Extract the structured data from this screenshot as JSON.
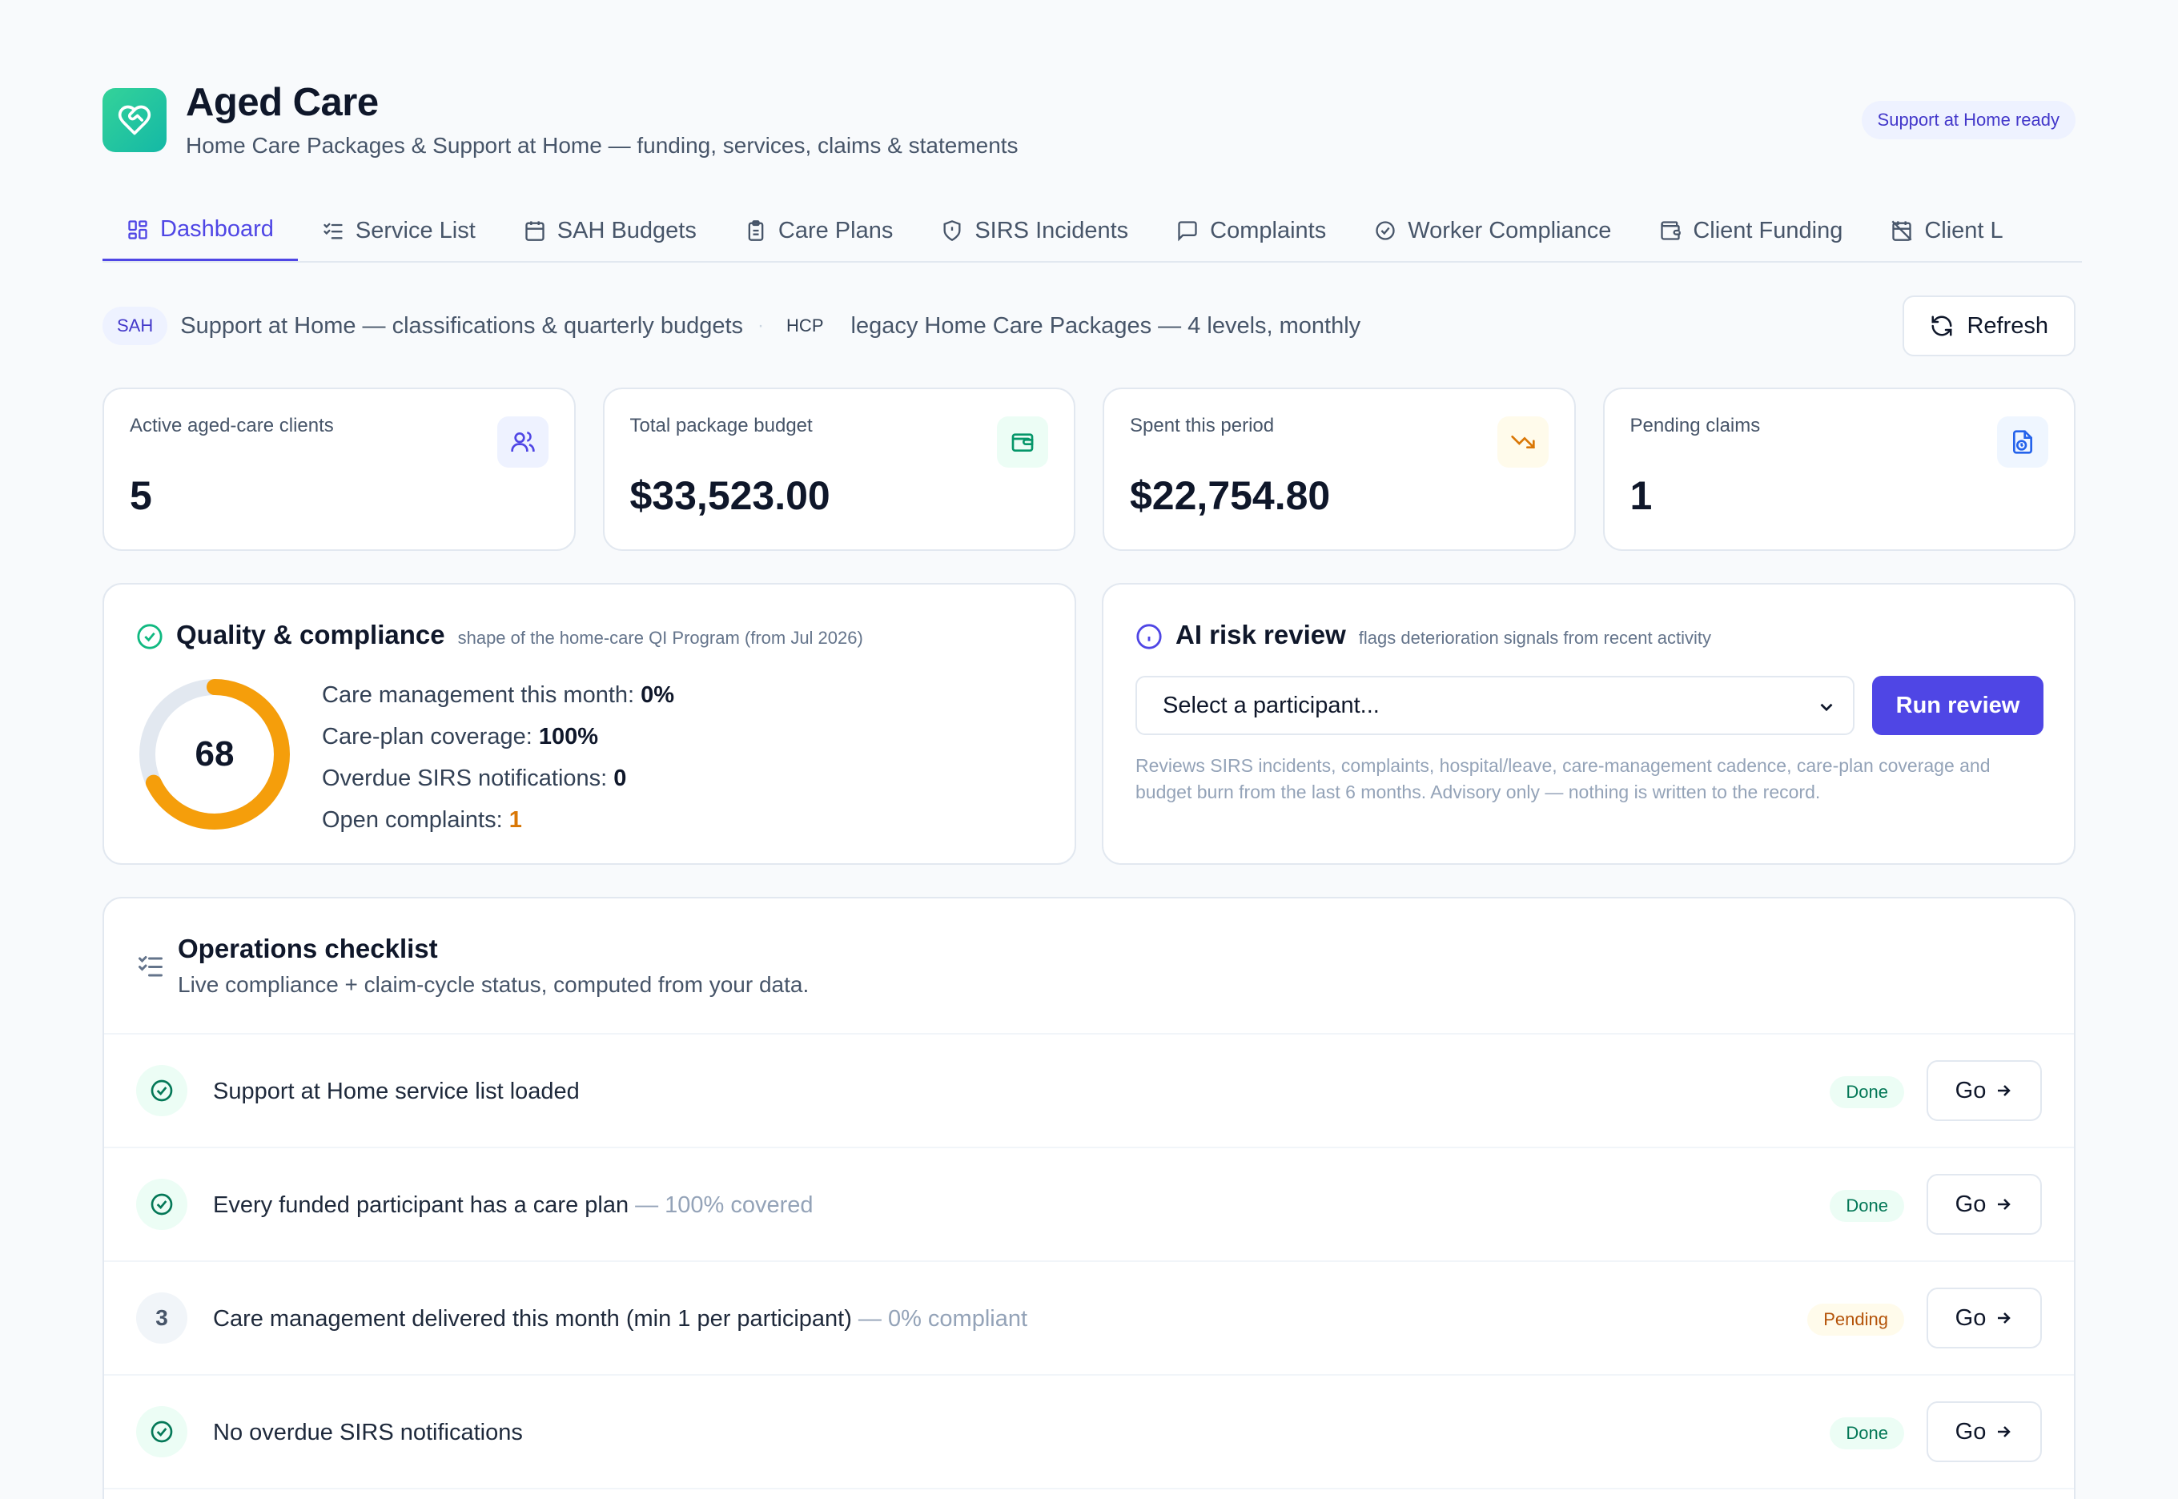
{
  "app": {
    "title": "Aged Care",
    "subtitle": "Home Care Packages & Support at Home — funding, services, claims & statements",
    "badge": "Support at Home ready"
  },
  "tabs": [
    {
      "label": "Dashboard",
      "icon": "grid-icon",
      "active": true
    },
    {
      "label": "Service List",
      "icon": "list-check-icon"
    },
    {
      "label": "SAH Budgets",
      "icon": "calendar-icon"
    },
    {
      "label": "Care Plans",
      "icon": "clipboard-icon"
    },
    {
      "label": "SIRS Incidents",
      "icon": "shield-icon"
    },
    {
      "label": "Complaints",
      "icon": "message-icon"
    },
    {
      "label": "Worker Compliance",
      "icon": "check-badge-icon"
    },
    {
      "label": "Client Funding",
      "icon": "wallet-icon"
    },
    {
      "label": "Client L",
      "icon": "calendar-off-icon"
    }
  ],
  "legend": {
    "sah_tag": "SAH",
    "sah_text": "Support at Home — classifications & quarterly budgets",
    "separator": "·",
    "hcp_tag": "HCP",
    "hcp_text": "legacy Home Care Packages — 4 levels, monthly",
    "refresh_label": "Refresh"
  },
  "stats": [
    {
      "label": "Active aged-care clients",
      "value": "5",
      "icon": "users-icon",
      "color": "#4f46e5",
      "bg": "#eef2ff"
    },
    {
      "label": "Total package budget",
      "value": "$33,523.00",
      "icon": "wallet-icon",
      "color": "#059669",
      "bg": "#ecfdf5"
    },
    {
      "label": "Spent this period",
      "value": "$22,754.80",
      "icon": "trending-down-icon",
      "color": "#d97706",
      "bg": "#fffbeb"
    },
    {
      "label": "Pending claims",
      "value": "1",
      "icon": "file-clock-icon",
      "color": "#2563eb",
      "bg": "#eff6ff"
    }
  ],
  "quality": {
    "title": "Quality & compliance",
    "subtitle": "shape of the home-care QI Program (from Jul 2026)",
    "score": "68",
    "score_value": 68,
    "items": [
      {
        "label": "Care management this month:",
        "value": "0%"
      },
      {
        "label": "Care-plan coverage:",
        "value": "100%"
      },
      {
        "label": "Overdue SIRS notifications:",
        "value": "0"
      },
      {
        "label": "Open complaints:",
        "value": "1"
      }
    ]
  },
  "ai": {
    "title": "AI risk review",
    "subtitle": "flags deterioration signals from recent activity",
    "select_placeholder": "Select a participant...",
    "run_label": "Run review",
    "note": "Reviews SIRS incidents, complaints, hospital/leave, care-management cadence, care-plan coverage and budget burn from the last 6 months. Advisory only — nothing is written to the record."
  },
  "checklist": {
    "title": "Operations checklist",
    "subtitle": "Live compliance + claim-cycle status, computed from your data.",
    "go_label": "Go",
    "rows": [
      {
        "text": "Support at Home service list loaded",
        "detail": "",
        "status": "Done",
        "marker": "check"
      },
      {
        "text": "Every funded participant has a care plan",
        "detail": "— 100% covered",
        "status": "Done",
        "marker": "check"
      },
      {
        "text": "Care management delivered this month (min 1 per participant)",
        "detail": "— 0% compliant",
        "status": "Pending",
        "marker": "3"
      },
      {
        "text": "No overdue SIRS notifications",
        "detail": "",
        "status": "Done",
        "marker": "check"
      }
    ]
  }
}
